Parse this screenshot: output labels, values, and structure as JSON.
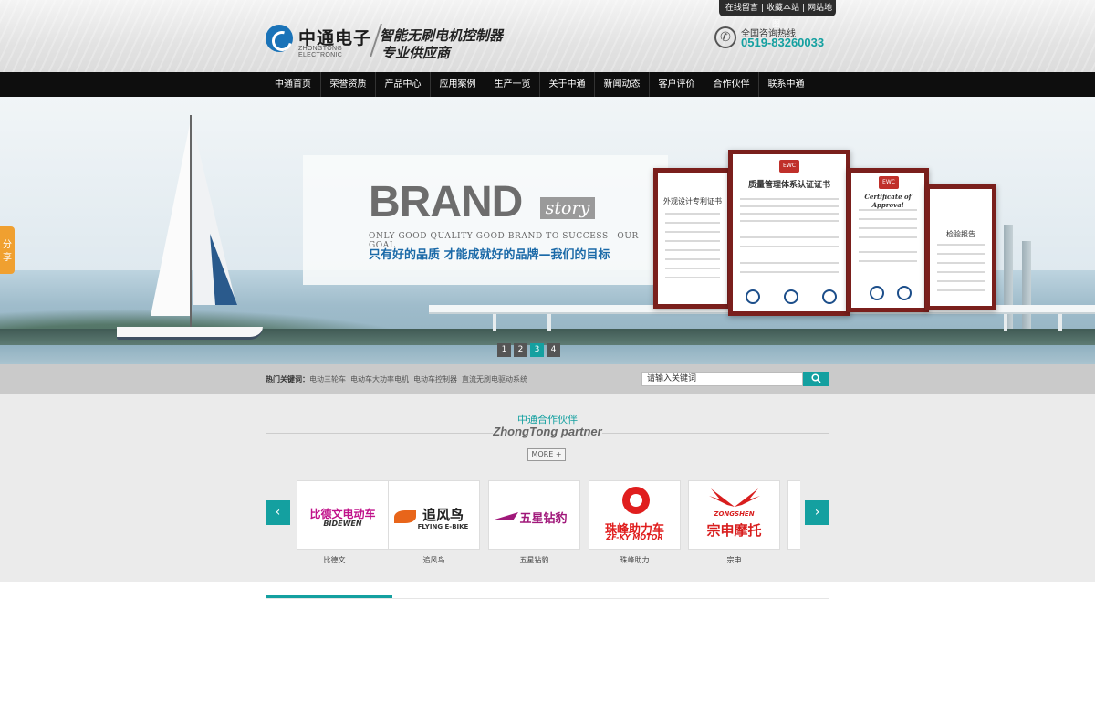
{
  "header": {
    "logo": {
      "cn": "中通电子",
      "en": "ZHONGTONG ELECTRONIC"
    },
    "slogan": [
      "智能无刷电机控制器",
      "专业供应商"
    ],
    "toplinks": [
      "在线留言",
      "收藏本站",
      "网站地图"
    ],
    "hotline": {
      "label": "全国咨询热线",
      "number": "0519-83260033",
      "icon": "phone-icon"
    }
  },
  "nav": {
    "items": [
      "中通首页",
      "荣誉资质",
      "产品中心",
      "应用案例",
      "生产一览",
      "关于中通",
      "新闻动态",
      "客户评价",
      "合作伙伴",
      "联系中通"
    ]
  },
  "banner": {
    "brand_word": "BRAND",
    "brand_story": "story",
    "tagline_en": "ONLY GOOD QUALITY GOOD BRAND TO SUCCESS—OUR GOAL",
    "tagline_cn": "只有好的品质  才能成就好的品牌—我们的目标",
    "cert_titles": [
      "外观设计专利证书",
      "质量管理体系认证证书",
      "Certificate of Approval",
      "检验报告"
    ],
    "cert_logo": "EWC",
    "slider": {
      "pages": [
        "1",
        "2",
        "3",
        "4"
      ],
      "active": "3"
    },
    "share_label": [
      "分",
      "享"
    ]
  },
  "hotbar": {
    "label": "热门关键词：",
    "keywords": [
      "电动三轮车",
      "电动车大功率电机",
      "电动车控制器",
      "直流无刷电驱动系统"
    ],
    "search_placeholder": "请输入关键词",
    "search_icon": "search-icon"
  },
  "partners": {
    "title_cn": "中通合作伙伴",
    "title_en": "ZhongTong partner",
    "more": "MORE +",
    "prev": "‹",
    "next": "›",
    "logos": [
      {
        "brand": "比德文电动车",
        "sub": "BIDEWEN",
        "caption": "比德文"
      },
      {
        "brand": "追风鸟",
        "sub": "FLYING E-BIKE",
        "caption": "追风鸟"
      },
      {
        "brand": "五星钻豹",
        "sub": "",
        "caption": "五星钻豹"
      },
      {
        "brand": "珠峰助力车",
        "sub": "ZF-KY MOTOR",
        "caption": "珠峰助力"
      },
      {
        "brand": "宗申摩托",
        "sub": "ZONGSHEN",
        "caption": "宗申"
      }
    ]
  },
  "colors": {
    "accent": "#14a0a0",
    "nav_bg": "#0e0e0e",
    "cert_frame": "#7a1f1c"
  }
}
